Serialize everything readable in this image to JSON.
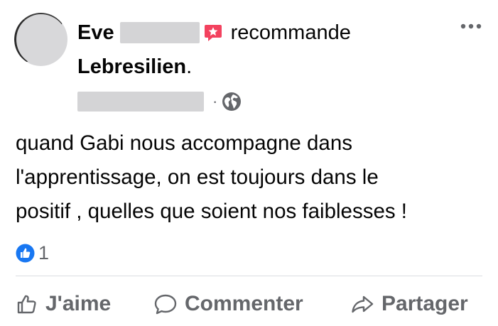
{
  "post": {
    "author_first_name": "Eve",
    "recommend_text": "recommande",
    "page_name": "Lebresilien",
    "page_name_suffix": ".",
    "meta_separator": "·",
    "body_lines": [
      "quand Gabi nous accompagne dans",
      "l'apprentissage, on est toujours dans le",
      "positif , quelles que soient nos faiblesses !"
    ],
    "reaction_count": "1"
  },
  "actions": {
    "like_label": "J'aime",
    "comment_label": "Commenter",
    "share_label": "Partager"
  },
  "icons": {
    "recommend": "recommend-star-icon",
    "audience": "globe-icon",
    "more": "more-options-icon",
    "reaction": "like-reaction-icon",
    "like": "thumbs-up-icon",
    "comment": "comment-bubble-icon",
    "share": "share-arrow-icon"
  },
  "colors": {
    "recommend_red": "#f3425f",
    "like_blue": "#1877f2",
    "secondary_text": "#65676b",
    "redaction_gray": "#d4d4d6"
  }
}
